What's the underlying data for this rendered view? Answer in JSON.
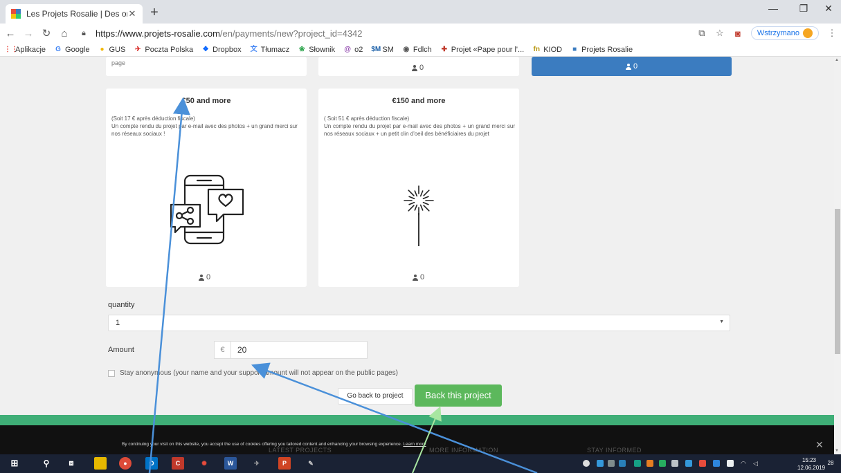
{
  "browser": {
    "tab_title": "Les Projets Rosalie | Des ordinate",
    "url_host": "https://www.projets-rosalie.com",
    "url_path": "/en/payments/new?project_id=4342",
    "profile_label": "Wstrzymano",
    "bookmarks": [
      {
        "label": "Aplikacje",
        "icon": "apps-grid-icon",
        "color": "#e8453c",
        "glyph": "⋮⋮"
      },
      {
        "label": "Google",
        "icon": "google-icon",
        "color": "#4285f4",
        "glyph": "G"
      },
      {
        "label": "GUS",
        "icon": "gus-icon",
        "color": "#f2b600",
        "glyph": "●"
      },
      {
        "label": "Poczta Polska",
        "icon": "poczta-icon",
        "color": "#d9302c",
        "glyph": "✈"
      },
      {
        "label": "Dropbox",
        "icon": "dropbox-icon",
        "color": "#0061fe",
        "glyph": "❖"
      },
      {
        "label": "Tłumacz",
        "icon": "translate-icon",
        "color": "#4285f4",
        "glyph": "文"
      },
      {
        "label": "Słownik",
        "icon": "dictionary-icon",
        "color": "#34a853",
        "glyph": "❀"
      },
      {
        "label": "o2",
        "icon": "o2-icon",
        "color": "#8e44ad",
        "glyph": "@"
      },
      {
        "label": "SM",
        "icon": "sm-icon",
        "color": "#1a5fa8",
        "glyph": "$M"
      },
      {
        "label": "Fdlch",
        "icon": "globe-icon",
        "color": "#555555",
        "glyph": "◉"
      },
      {
        "label": "Projet «Pape pour l'...",
        "icon": "projet-icon",
        "color": "#c0392b",
        "glyph": "✚"
      },
      {
        "label": "KIOD",
        "icon": "kiod-icon",
        "color": "#b7950b",
        "glyph": "fn"
      },
      {
        "label": "Projets Rosalie",
        "icon": "rosalie-icon",
        "color": "#3b7cc0",
        "glyph": "■"
      }
    ]
  },
  "top_cards": {
    "card1_word": "page",
    "card2_count": "0",
    "card3_count": "0"
  },
  "rewards": [
    {
      "title": "€50 and more",
      "description": "(Soit 17 € après déduction fiscale)\nUn compte rendu du projet par e-mail avec des photos + un grand merci sur nos réseaux sociaux !",
      "count": "0",
      "icon": "phone-social-icon"
    },
    {
      "title": "€150 and more",
      "description": "( Soit 51 € après déduction fiscale)\nUn compte rendu du projet par e-mail avec des photos + un grand merci sur nos réseaux sociaux + un petit clin d'oeil des bénéficiaires du projet",
      "count": "0",
      "icon": "sparkler-icon"
    }
  ],
  "form": {
    "quantity_label": "quantity",
    "quantity_value": "1",
    "amount_label": "Amount",
    "currency": "€",
    "amount_value": "20",
    "anonymous_label": "Stay anonymous (your name and your support amount will not appear on the public pages)",
    "back_button": "Go back to project",
    "submit_button": "Back this project"
  },
  "footer": {
    "cookie_text": "By continuing your visit on this website, you accept the use of cookies offering you tailored content and enhancing your browsing experience.",
    "cookie_link": "Learn more",
    "heading_latest": "LATEST PROJECTS",
    "heading_more": "MORE INFORMATION",
    "heading_stay": "STAY INFORMED"
  },
  "taskbar": {
    "time": "15:23",
    "date": "12.06.2019",
    "notifications": "28"
  },
  "colors": {
    "primary_blue": "#3b7cc0",
    "success_green": "#5cb85c",
    "band_green": "#3fae77",
    "arrow_blue": "#4a90d9",
    "arrow_green": "#a8e6a1"
  }
}
